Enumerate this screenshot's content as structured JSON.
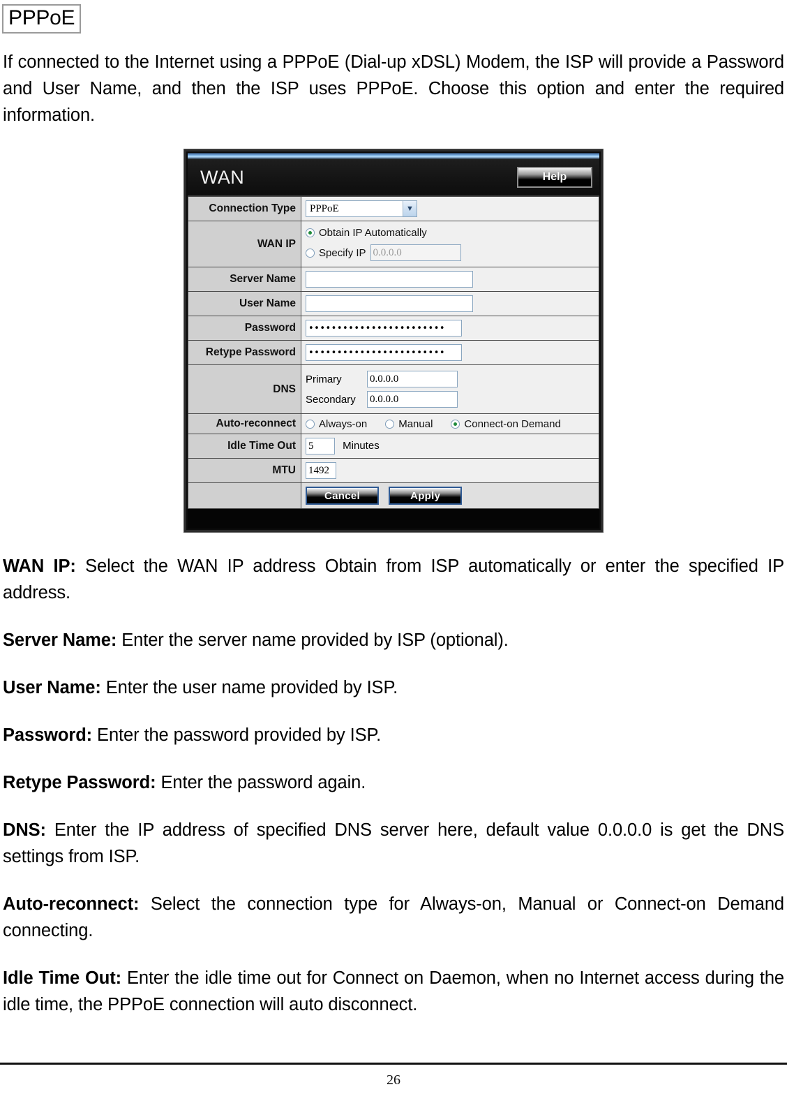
{
  "document": {
    "section_heading": "PPPoE",
    "intro_paragraph": "If connected to the Internet using a PPPoE (Dial-up xDSL) Modem, the ISP will provide a Password and User Name, and then the ISP uses PPPoE. Choose this option and enter the required information.",
    "page_number": "26",
    "definitions": [
      {
        "term": "WAN IP:",
        "text": " Select the WAN IP address Obtain from ISP automatically or enter the specified IP address."
      },
      {
        "term": "Server Name:",
        "text": " Enter the server name provided by ISP (optional)."
      },
      {
        "term": "User Name:",
        "text": " Enter the user name provided by ISP."
      },
      {
        "term": "Password:",
        "text": " Enter the password provided by ISP."
      },
      {
        "term": "Retype Password:",
        "text": " Enter the password again."
      },
      {
        "term": "DNS:",
        "text": " Enter the IP address of specified DNS server here, default value 0.0.0.0 is get the DNS settings from ISP."
      },
      {
        "term": "Auto-reconnect:",
        "text": " Select the connection type for Always-on, Manual or Connect-on Demand connecting."
      },
      {
        "term": "Idle Time Out:",
        "text": " Enter the idle time out for Connect on Daemon, when no Internet access during the idle time, the PPPoE connection will auto disconnect."
      }
    ]
  },
  "router_ui": {
    "title": "WAN",
    "help_label": "Help",
    "rows": {
      "connection_type": {
        "label": "Connection Type",
        "selected": "PPPoE",
        "options": [
          "PPPoE"
        ],
        "arrow_icon": "chevron-down-icon"
      },
      "wan_ip": {
        "label": "WAN IP",
        "obtain_label": "Obtain IP Automatically",
        "obtain_selected": true,
        "specify_label": "Specify IP",
        "specify_selected": false,
        "specify_value": "0.0.0.0"
      },
      "server_name": {
        "label": "Server Name",
        "value": ""
      },
      "user_name": {
        "label": "User Name",
        "value": ""
      },
      "password": {
        "label": "Password",
        "value": "••••••••••••••••••••••••"
      },
      "retype_password": {
        "label": "Retype Password",
        "value": "••••••••••••••••••••••••"
      },
      "dns": {
        "label": "DNS",
        "primary_label": "Primary",
        "primary_value": "0.0.0.0",
        "secondary_label": "Secondary",
        "secondary_value": "0.0.0.0"
      },
      "auto_reconnect": {
        "label": "Auto-reconnect",
        "options": [
          {
            "label": "Always-on",
            "selected": false
          },
          {
            "label": "Manual",
            "selected": false
          },
          {
            "label": "Connect-on Demand",
            "selected": true
          }
        ]
      },
      "idle_time_out": {
        "label": "Idle Time Out",
        "value": "5",
        "unit": "Minutes"
      },
      "mtu": {
        "label": "MTU",
        "value": "1492"
      }
    },
    "buttons": {
      "cancel": "Cancel",
      "apply": "Apply"
    },
    "colors": {
      "panel_background": "#0b0b0b",
      "label_column": "#d0d0d0",
      "field_background": "#f0f0f0",
      "accent_strip": "#8ec2ef",
      "radio_selected": "#1f8a3b"
    }
  }
}
